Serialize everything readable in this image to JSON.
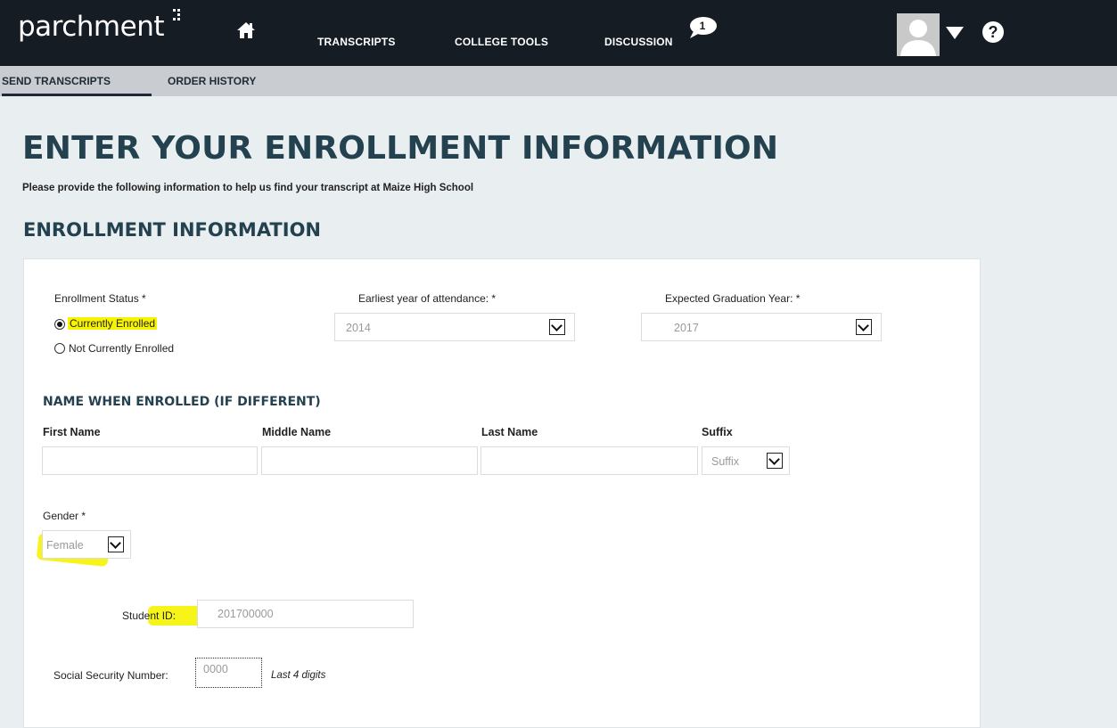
{
  "header": {
    "logo": "parchment",
    "nav": [
      "TRANSCRIPTS",
      "COLLEGE TOOLS",
      "DISCUSSION"
    ],
    "discussion_badge": "1",
    "help": "?"
  },
  "subnav": {
    "items": [
      "SEND TRANSCRIPTS",
      "ORDER HISTORY"
    ],
    "active": "SEND TRANSCRIPTS"
  },
  "page": {
    "title": "ENTER YOUR ENROLLMENT INFORMATION",
    "intro": "Please provide the following information to help us find your transcript at Maize High School",
    "section_title": "ENROLLMENT INFORMATION"
  },
  "form": {
    "enrollment_status": {
      "label": "Enrollment Status *",
      "options": [
        "Currently Enrolled",
        "Not Currently Enrolled"
      ],
      "selected": "Currently Enrolled"
    },
    "earliest_year": {
      "label": "Earliest year of attendance: *",
      "value": "2014"
    },
    "graduation_year": {
      "label": "Expected Graduation Year: *",
      "value": "2017"
    },
    "name_section": {
      "title": "NAME WHEN ENROLLED (IF DIFFERENT)",
      "first_label": "First Name",
      "middle_label": "Middle Name",
      "last_label": "Last Name",
      "suffix_label": "Suffix",
      "suffix_value": "Suffix"
    },
    "gender": {
      "label": "Gender *",
      "value": "Female"
    },
    "student_id": {
      "label": "Student ID:",
      "value": "201700000"
    },
    "ssn": {
      "label": "Social Security Number:",
      "value": "0000",
      "hint": "Last 4 digits"
    }
  },
  "colors": {
    "topbar": "#161c23",
    "subbar": "#c9cdd1",
    "heading": "#24414f",
    "highlight": "#f8f400"
  }
}
